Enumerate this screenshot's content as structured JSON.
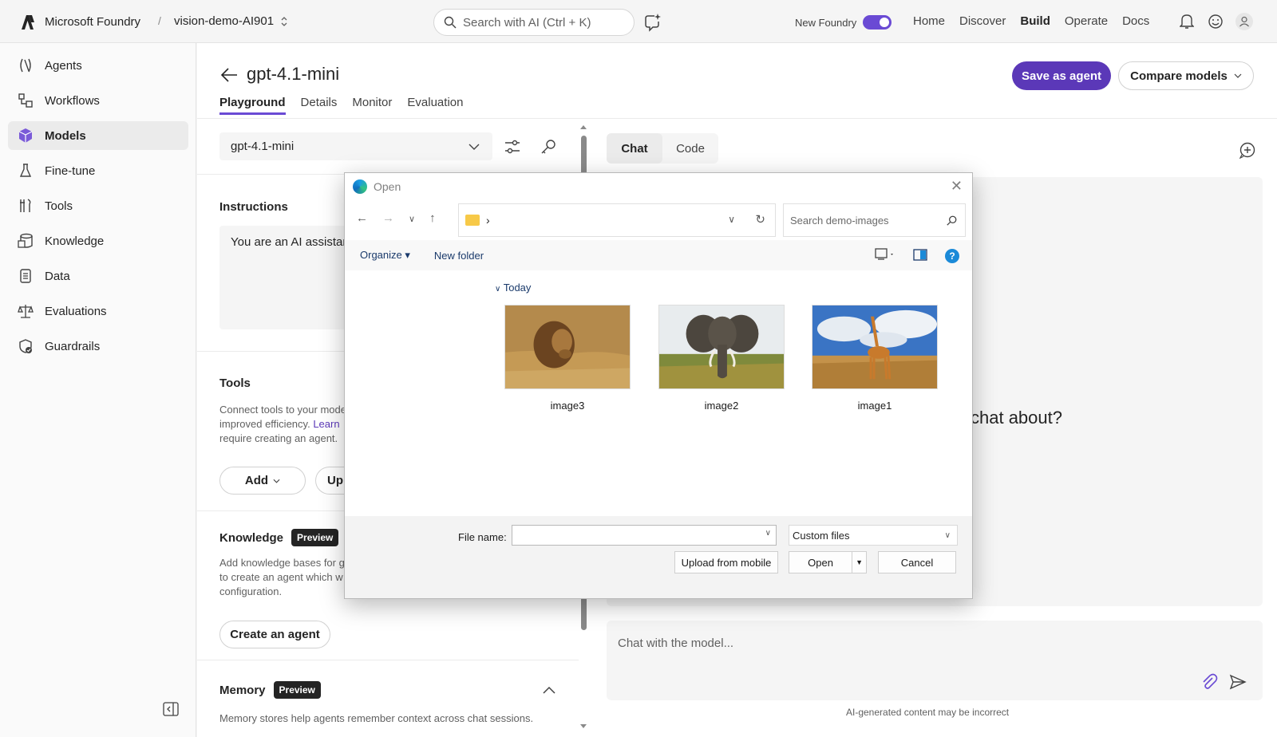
{
  "topbar": {
    "brand": "Microsoft Foundry",
    "separator": "/",
    "project": "vision-demo-AI901",
    "search_placeholder": "Search with AI (Ctrl + K)",
    "new_foundry_label": "New Foundry",
    "nav": [
      "Home",
      "Discover",
      "Build",
      "Operate",
      "Docs"
    ],
    "active_nav": "Build"
  },
  "sidebar": {
    "items": [
      {
        "label": "Agents",
        "icon": "agents-icon"
      },
      {
        "label": "Workflows",
        "icon": "workflows-icon"
      },
      {
        "label": "Models",
        "icon": "models-icon",
        "active": true
      },
      {
        "label": "Fine-tune",
        "icon": "flask-icon"
      },
      {
        "label": "Tools",
        "icon": "tools-icon"
      },
      {
        "label": "Knowledge",
        "icon": "knowledge-icon"
      },
      {
        "label": "Data",
        "icon": "data-icon"
      },
      {
        "label": "Evaluations",
        "icon": "scale-icon"
      },
      {
        "label": "Guardrails",
        "icon": "shield-icon"
      }
    ]
  },
  "page": {
    "title": "gpt-4.1-mini",
    "tabs": [
      "Playground",
      "Details",
      "Monitor",
      "Evaluation"
    ],
    "save_agent": "Save as agent",
    "compare_models": "Compare models"
  },
  "config": {
    "model_select": "gpt-4.1-mini",
    "instructions_label": "Instructions",
    "instructions_value": "You are an AI assistar",
    "tools_label": "Tools",
    "tools_desc_1": "Connect tools to your mode",
    "tools_desc_2_prefix": "improved efficiency.",
    "tools_desc_2_link": "Learn",
    "tools_desc_3": "require creating an agent.",
    "add_button": "Add",
    "upload_button": "Upl",
    "knowledge_label": "Knowledge",
    "knowledge_badge": "Preview",
    "knowledge_desc_1": "Add knowledge bases for g",
    "knowledge_desc_2": "to create an agent which w",
    "knowledge_desc_3": "configuration.",
    "create_agent_button": "Create an agent",
    "memory_label": "Memory",
    "memory_badge": "Preview",
    "memory_desc": "Memory stores help agents remember context across chat sessions."
  },
  "chat": {
    "tabs": [
      "Chat",
      "Code"
    ],
    "active_tab": "Chat",
    "prompt_fragment": "chat about?",
    "input_placeholder": "Chat with the model...",
    "disclaimer": "AI-generated content may be incorrect"
  },
  "dialog": {
    "title": "Open",
    "path_separator": "›",
    "search_placeholder": "Search demo-images",
    "organize": "Organize",
    "new_folder": "New folder",
    "group": "Today",
    "files": [
      {
        "name": "image3",
        "subject": "lion"
      },
      {
        "name": "image2",
        "subject": "elephant"
      },
      {
        "name": "image1",
        "subject": "giraffe"
      }
    ],
    "file_name_label": "File name:",
    "file_name_value": "",
    "filter": "Custom files",
    "upload_mobile": "Upload from mobile",
    "open": "Open",
    "cancel": "Cancel"
  },
  "colors": {
    "accent": "#5b38b8",
    "toggle": "#6a4ad4"
  }
}
